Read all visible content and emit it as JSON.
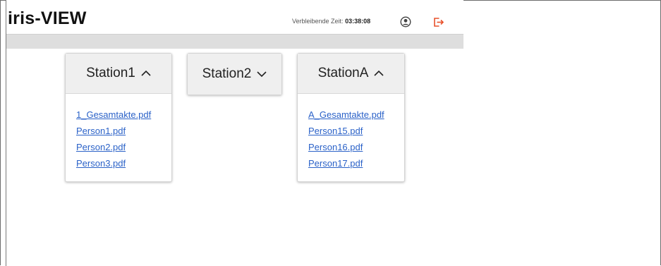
{
  "header": {
    "logo": "iris-VIEW",
    "timer_label": "Verbleibende Zeit:",
    "timer_value": "03:38:08",
    "icons": [
      "user-circle-icon",
      "logout-icon"
    ],
    "logout_color": "#e8502a"
  },
  "stations": [
    {
      "name": "Station1",
      "expanded": true,
      "files": [
        "1_Gesamtakte.pdf",
        "Person1.pdf",
        "Person2.pdf",
        "Person3.pdf"
      ]
    },
    {
      "name": "Station2",
      "expanded": false,
      "files": []
    },
    {
      "name": "StationA",
      "expanded": true,
      "files": [
        "A_Gesamtakte.pdf",
        "Person15.pdf",
        "Person16.pdf",
        "Person17.pdf"
      ]
    }
  ],
  "colors": {
    "link": "#2b62c8",
    "card_header_bg": "#efefef",
    "subbar_bg": "#dedede"
  }
}
